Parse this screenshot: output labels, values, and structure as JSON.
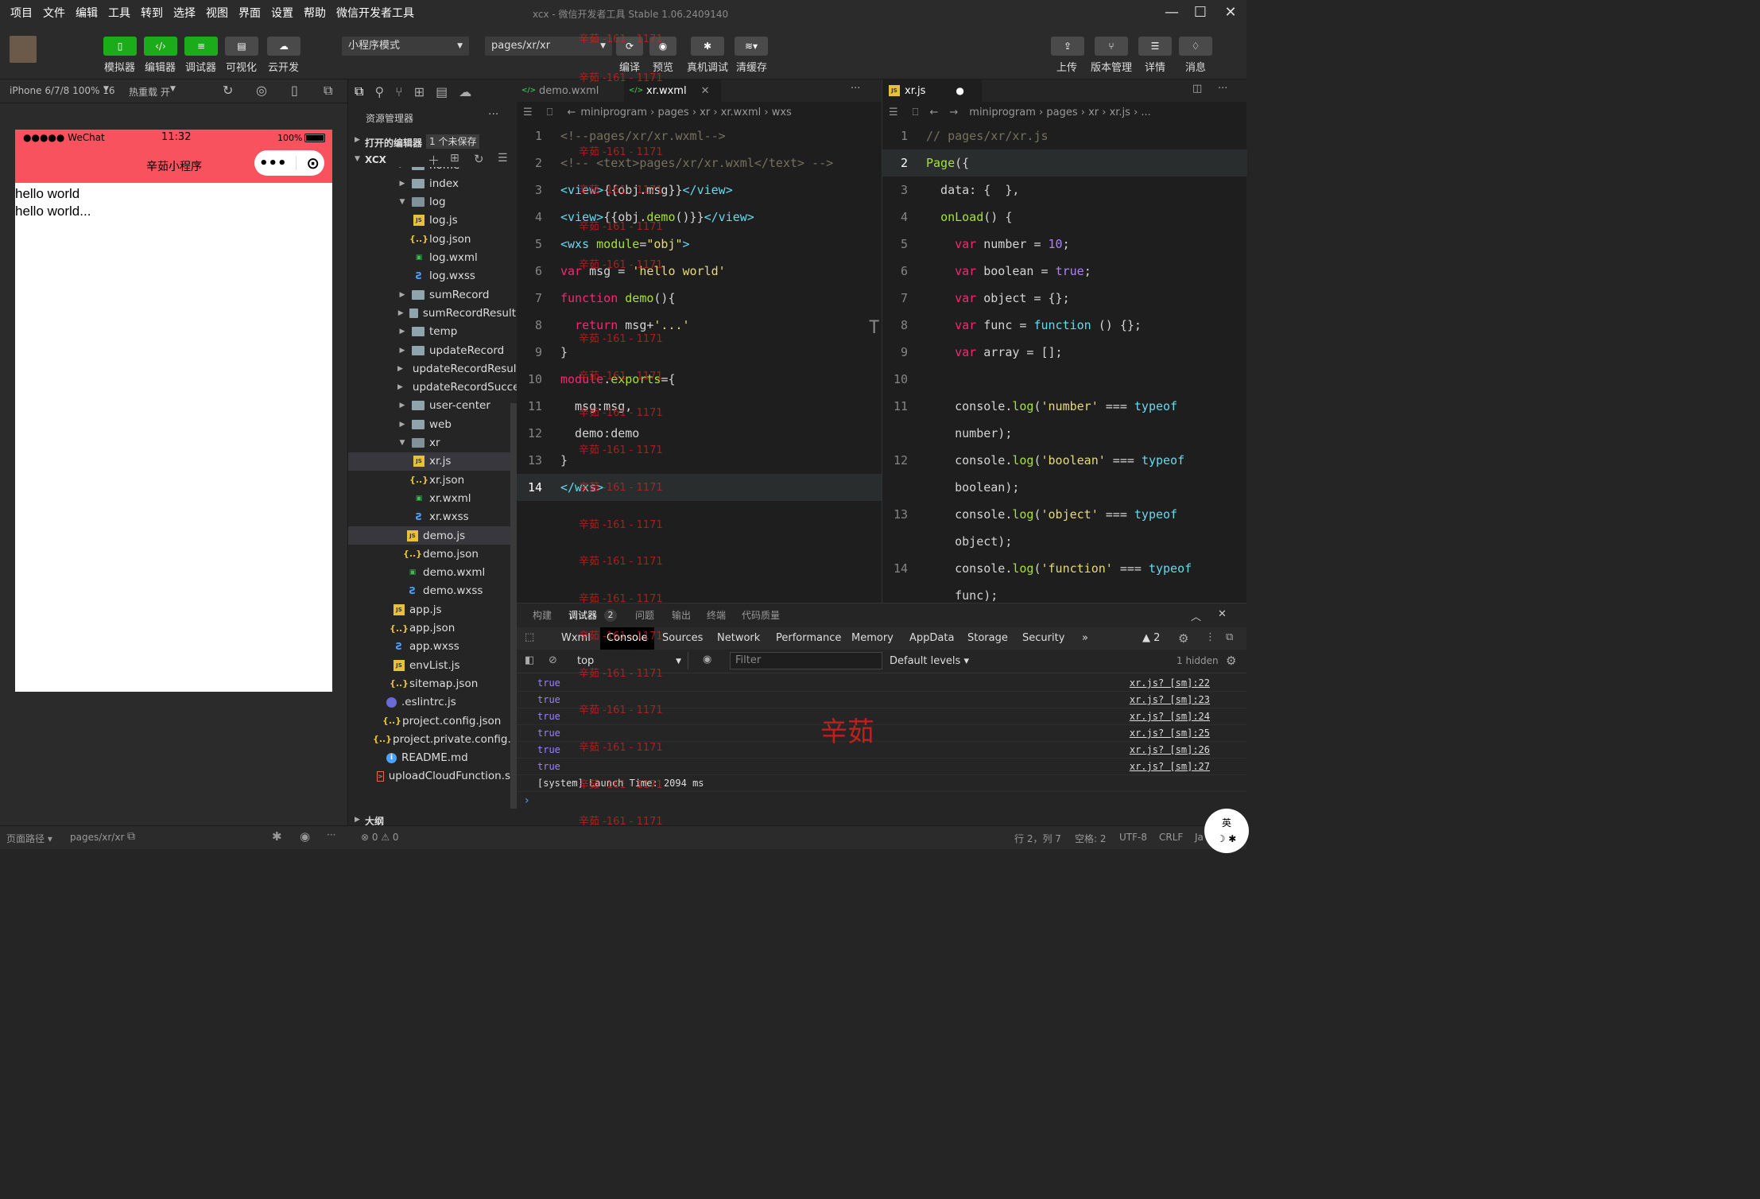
{
  "menu": [
    "项目",
    "文件",
    "编辑",
    "工具",
    "转到",
    "选择",
    "视图",
    "界面",
    "设置",
    "帮助",
    "微信开发者工具"
  ],
  "window_title": "xcx - 微信开发者工具 Stable 1.06.2409140",
  "toolbar": {
    "simulator": "模拟器",
    "editor": "编辑器",
    "debugger": "调试器",
    "visual": "可视化",
    "cloud": "云开发",
    "mode": "小程序模式",
    "page": "pages/xr/xr",
    "compile": "编译",
    "preview": "预览",
    "realdevice": "真机调试",
    "clearcache": "清缓存",
    "upload": "上传",
    "version": "版本管理",
    "detail": "详情",
    "message": "消息"
  },
  "simbar": {
    "device": "iPhone 6/7/8 100% 16",
    "hotreload": "热重载 开"
  },
  "phone": {
    "carrier": "●●●●● WeChat",
    "time": "11:32",
    "battery": "100%",
    "title": "辛茹小程序",
    "lines": [
      "hello world",
      "hello world..."
    ]
  },
  "explorer": {
    "header": "资源管理器",
    "open_editors": "打开的编辑器",
    "unsaved": "1 个未保存",
    "project": "XCX",
    "outline": "大纲",
    "items": [
      {
        "label": "home",
        "icon": "folder",
        "tw": "›",
        "indent": 2
      },
      {
        "label": "index",
        "icon": "folder",
        "tw": "›",
        "indent": 2
      },
      {
        "label": "log",
        "icon": "folderopen",
        "tw": "⌄",
        "indent": 2
      },
      {
        "label": "log.js",
        "icon": "js",
        "tw": "",
        "indent": 3
      },
      {
        "label": "log.json",
        "icon": "json",
        "tw": "",
        "indent": 3
      },
      {
        "label": "log.wxml",
        "icon": "wxml",
        "tw": "",
        "indent": 3
      },
      {
        "label": "log.wxss",
        "icon": "wxss",
        "tw": "",
        "indent": 3
      },
      {
        "label": "sumRecord",
        "icon": "folder",
        "tw": "›",
        "indent": 2
      },
      {
        "label": "sumRecordResult",
        "icon": "folder",
        "tw": "›",
        "indent": 2
      },
      {
        "label": "temp",
        "icon": "folder",
        "tw": "›",
        "indent": 2
      },
      {
        "label": "updateRecord",
        "icon": "folder",
        "tw": "›",
        "indent": 2
      },
      {
        "label": "updateRecordResult",
        "icon": "folder",
        "tw": "›",
        "indent": 2
      },
      {
        "label": "updateRecordSuccess",
        "icon": "folder",
        "tw": "›",
        "indent": 2
      },
      {
        "label": "user-center",
        "icon": "folder",
        "tw": "›",
        "indent": 2
      },
      {
        "label": "web",
        "icon": "folder",
        "tw": "›",
        "indent": 2
      },
      {
        "label": "xr",
        "icon": "folderopen",
        "tw": "⌄",
        "indent": 2
      },
      {
        "label": "xr.js",
        "icon": "js",
        "tw": "",
        "indent": 3,
        "selected": true
      },
      {
        "label": "xr.json",
        "icon": "json",
        "tw": "",
        "indent": 3
      },
      {
        "label": "xr.wxml",
        "icon": "wxml",
        "tw": "",
        "indent": 3
      },
      {
        "label": "xr.wxss",
        "icon": "wxss",
        "tw": "",
        "indent": 3
      },
      {
        "label": "demo.js",
        "icon": "js",
        "tw": "",
        "indent": 2,
        "selected": true
      },
      {
        "label": "demo.json",
        "icon": "json",
        "tw": "",
        "indent": 2
      },
      {
        "label": "demo.wxml",
        "icon": "wxml",
        "tw": "",
        "indent": 2
      },
      {
        "label": "demo.wxss",
        "icon": "wxss",
        "tw": "",
        "indent": 2
      },
      {
        "label": "app.js",
        "icon": "js",
        "tw": "",
        "indent": 1
      },
      {
        "label": "app.json",
        "icon": "json",
        "tw": "",
        "indent": 1
      },
      {
        "label": "app.wxss",
        "icon": "wxss",
        "tw": "",
        "indent": 1
      },
      {
        "label": "envList.js",
        "icon": "js",
        "tw": "",
        "indent": 1
      },
      {
        "label": "sitemap.json",
        "icon": "json",
        "tw": "",
        "indent": 1
      },
      {
        "label": ".eslintrc.js",
        "icon": "eslint",
        "tw": "",
        "indent": 0
      },
      {
        "label": "project.config.json",
        "icon": "json",
        "tw": "",
        "indent": 0
      },
      {
        "label": "project.private.config.js...",
        "icon": "json",
        "tw": "",
        "indent": 0
      },
      {
        "label": "README.md",
        "icon": "info",
        "tw": "",
        "indent": 0
      },
      {
        "label": "uploadCloudFunction.sh",
        "icon": "sh",
        "tw": "",
        "indent": 0
      }
    ]
  },
  "editor1": {
    "tabs": [
      "demo.wxml",
      "xr.wxml"
    ],
    "crumbs": "miniprogram › pages › xr › xr.wxml › wxs"
  },
  "editor2": {
    "tab": "xr.js",
    "crumbs": "miniprogram › pages › xr › xr.js › ..."
  },
  "bottom": {
    "tabs": [
      "构建",
      "调试器",
      "问题",
      "输出",
      "终端",
      "代码质量"
    ],
    "debugger_count": "2",
    "devtabs": [
      "Wxml",
      "Console",
      "Sources",
      "Network",
      "Performance",
      "Memory",
      "AppData",
      "Storage",
      "Security"
    ],
    "more": "»",
    "warnings": "▲ 2",
    "context": "top",
    "filter_placeholder": "Filter",
    "levels": "Default levels ▾",
    "hidden": "1 hidden",
    "logs": [
      {
        "value": "true",
        "src": "xr.js? [sm]:22"
      },
      {
        "value": "true",
        "src": "xr.js? [sm]:23"
      },
      {
        "value": "true",
        "src": "xr.js? [sm]:24"
      },
      {
        "value": "true",
        "src": "xr.js? [sm]:25"
      },
      {
        "value": "true",
        "src": "xr.js? [sm]:26"
      },
      {
        "value": "true",
        "src": "xr.js? [sm]:27"
      }
    ],
    "system": "[system] Launch Time: 2094 ms",
    "prompt": "›"
  },
  "status": {
    "path_label": "页面路径 ▾",
    "path": "pages/xr/xr",
    "errors": "⊗ 0 ⚠ 0",
    "pos": "行 2，列 7",
    "spaces": "空格: 2",
    "enc": "UTF-8",
    "eol": "CRLF",
    "lang": "Ja"
  },
  "watermark": {
    "text": "辛茹 -161 - 1171",
    "big": "辛茹"
  },
  "colors": {
    "accent": "#1aad19",
    "phone_bar": "#f8525e"
  }
}
